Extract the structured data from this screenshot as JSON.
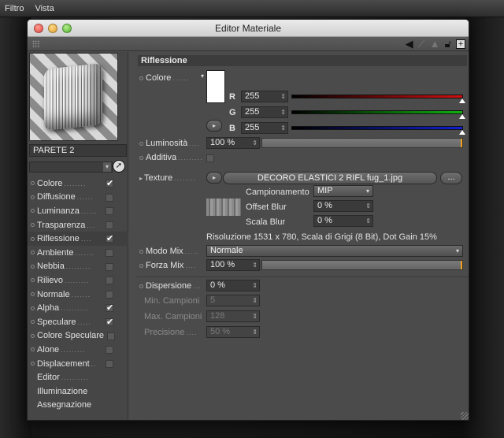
{
  "menubar": {
    "items": [
      "Filtro",
      "Vista"
    ]
  },
  "window": {
    "title": "Editor Materiale"
  },
  "material": {
    "name": "PARETE 2"
  },
  "channels": [
    {
      "label": "Colore",
      "checked": true
    },
    {
      "label": "Diffusione",
      "checked": false
    },
    {
      "label": "Luminanza",
      "checked": false
    },
    {
      "label": "Trasparenza",
      "checked": false
    },
    {
      "label": "Riflessione",
      "checked": true,
      "active": true
    },
    {
      "label": "Ambiente",
      "checked": false
    },
    {
      "label": "Nebbia",
      "checked": false
    },
    {
      "label": "Rilievo",
      "checked": false
    },
    {
      "label": "Normale",
      "checked": false
    },
    {
      "label": "Alpha",
      "checked": true
    },
    {
      "label": "Speculare",
      "checked": true
    },
    {
      "label": "Colore Speculare",
      "checked": false
    },
    {
      "label": "Alone",
      "checked": false
    },
    {
      "label": "Displacement",
      "checked": false
    }
  ],
  "sections": [
    "Editor",
    "Illuminazione",
    "Assegnazione"
  ],
  "reflection": {
    "header": "Riflessione",
    "color_label": "Colore",
    "r_label": "R",
    "g_label": "G",
    "b_label": "B",
    "r": "255",
    "g": "255",
    "b": "255",
    "swatch_color": "#ffffff",
    "brightness_label": "Luminosità",
    "brightness": "100 %",
    "additive_label": "Additiva",
    "texture_label": "Texture",
    "texture_file": "DECORO ELASTICI 2 RIFL fug_1.jpg",
    "texture_more": "...",
    "sampling_label": "Campionamento",
    "sampling": "MIP",
    "offset_blur_label": "Offset Blur",
    "offset_blur": "0 %",
    "scale_blur_label": "Scala Blur",
    "scale_blur": "0 %",
    "resolution_info": "Risoluzione 1531 x 780, Scala di Grigi (8 Bit), Dot Gain 15%",
    "mix_mode_label": "Modo Mix",
    "mix_mode": "Normale",
    "mix_strength_label": "Forza Mix",
    "mix_strength": "100 %",
    "dispersion_label": "Dispersione",
    "dispersion": "0 %",
    "min_samples_label": "Min. Campioni",
    "min_samples": "5",
    "max_samples_label": "Max. Campioni",
    "max_samples": "128",
    "precision_label": "Precisione",
    "precision": "50 %"
  },
  "colors": {
    "accent_slider": "#f2a020",
    "bar_red": "#d01010",
    "bar_green": "#10b010",
    "bar_blue": "#1020d0"
  }
}
